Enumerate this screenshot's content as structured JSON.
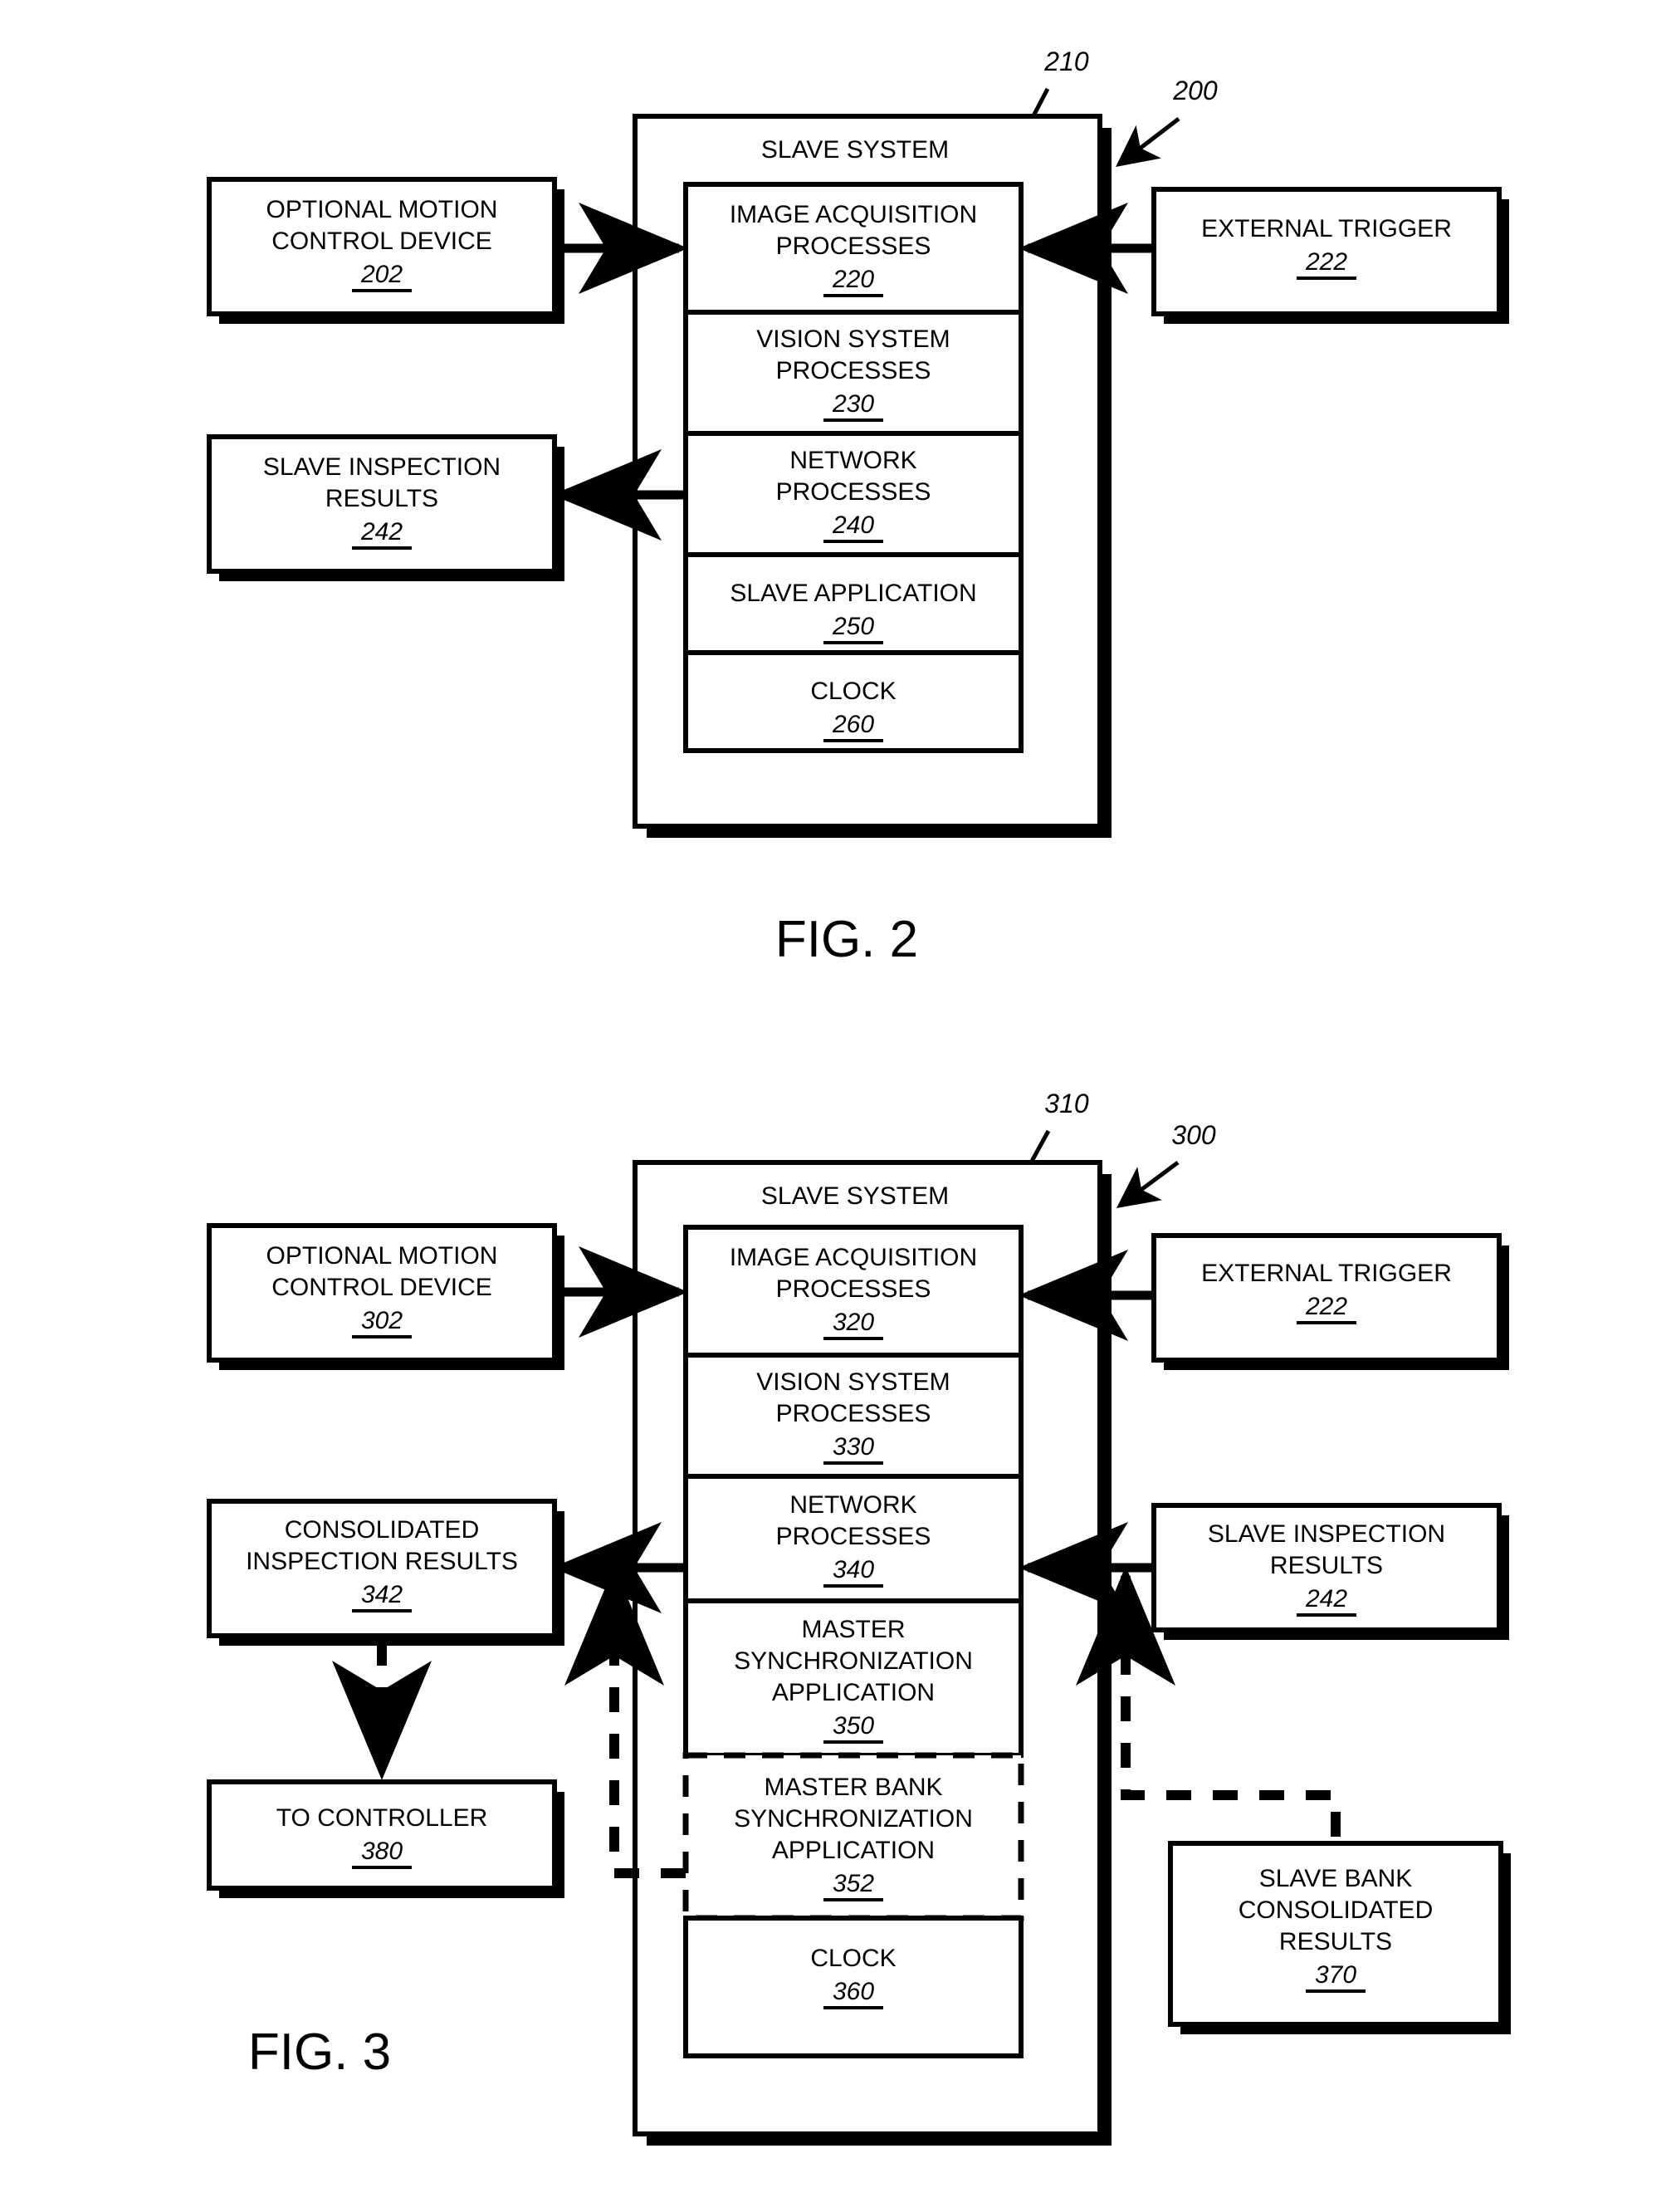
{
  "document": {
    "type": "patent-figure-sheet",
    "figures": [
      {
        "id": "fig2",
        "label": "FIG. 2",
        "system_ref": "200",
        "stack_ref": "210",
        "container": {
          "title": "SLAVE SYSTEM"
        },
        "stack_modules": [
          {
            "name": "IMAGE ACQUISITION PROCESSES",
            "lines": [
              "IMAGE ACQUISITION",
              "PROCESSES"
            ],
            "ref": "220",
            "dashed": false
          },
          {
            "name": "VISION SYSTEM PROCESSES",
            "lines": [
              "VISION SYSTEM",
              "PROCESSES"
            ],
            "ref": "230",
            "dashed": false
          },
          {
            "name": "NETWORK PROCESSES",
            "lines": [
              "NETWORK",
              "PROCESSES"
            ],
            "ref": "240",
            "dashed": false
          },
          {
            "name": "SLAVE APPLICATION",
            "lines": [
              "SLAVE APPLICATION"
            ],
            "ref": "250",
            "dashed": false
          },
          {
            "name": "CLOCK",
            "lines": [
              "CLOCK"
            ],
            "ref": "260",
            "dashed": false
          }
        ],
        "side_boxes": [
          {
            "name": "OPTIONAL MOTION CONTROL DEVICE",
            "lines": [
              "OPTIONAL MOTION",
              "CONTROL DEVICE"
            ],
            "ref": "202",
            "side": "left"
          },
          {
            "name": "SLAVE INSPECTION RESULTS",
            "lines": [
              "SLAVE INSPECTION",
              "RESULTS"
            ],
            "ref": "242",
            "side": "left"
          },
          {
            "name": "EXTERNAL TRIGGER",
            "lines": [
              "EXTERNAL TRIGGER"
            ],
            "ref": "222",
            "side": "right"
          }
        ]
      },
      {
        "id": "fig3",
        "label": "FIG. 3",
        "system_ref": "300",
        "stack_ref": "310",
        "container": {
          "title": "SLAVE SYSTEM"
        },
        "stack_modules": [
          {
            "name": "IMAGE ACQUISITION PROCESSES",
            "lines": [
              "IMAGE ACQUISITION",
              "PROCESSES"
            ],
            "ref": "320",
            "dashed": false
          },
          {
            "name": "VISION SYSTEM PROCESSES",
            "lines": [
              "VISION SYSTEM",
              "PROCESSES"
            ],
            "ref": "330",
            "dashed": false
          },
          {
            "name": "NETWORK PROCESSES",
            "lines": [
              "NETWORK",
              "PROCESSES"
            ],
            "ref": "340",
            "dashed": false
          },
          {
            "name": "MASTER SYNCHRONIZATION APPLICATION",
            "lines": [
              "MASTER",
              "SYNCHRONIZATION",
              "APPLICATION"
            ],
            "ref": "350",
            "dashed": false
          },
          {
            "name": "MASTER BANK SYNCHRONIZATION APPLICATION",
            "lines": [
              "MASTER BANK",
              "SYNCHRONIZATION",
              "APPLICATION"
            ],
            "ref": "352",
            "dashed": true
          },
          {
            "name": "CLOCK",
            "lines": [
              "CLOCK"
            ],
            "ref": "360",
            "dashed": false
          }
        ],
        "side_boxes": [
          {
            "name": "OPTIONAL MOTION CONTROL DEVICE",
            "lines": [
              "OPTIONAL MOTION",
              "CONTROL DEVICE"
            ],
            "ref": "302",
            "side": "left"
          },
          {
            "name": "CONSOLIDATED INSPECTION RESULTS",
            "lines": [
              "CONSOLIDATED",
              "INSPECTION RESULTS"
            ],
            "ref": "342",
            "side": "left"
          },
          {
            "name": "TO CONTROLLER",
            "lines": [
              "TO CONTROLLER"
            ],
            "ref": "380",
            "side": "left"
          },
          {
            "name": "EXTERNAL TRIGGER",
            "lines": [
              "EXTERNAL TRIGGER"
            ],
            "ref": "222",
            "side": "right"
          },
          {
            "name": "SLAVE INSPECTION RESULTS",
            "lines": [
              "SLAVE INSPECTION",
              "RESULTS"
            ],
            "ref": "242",
            "side": "right"
          },
          {
            "name": "SLAVE BANK CONSOLIDATED RESULTS",
            "lines": [
              "SLAVE BANK",
              "CONSOLIDATED",
              "RESULTS"
            ],
            "ref": "370",
            "side": "right"
          }
        ]
      }
    ],
    "colors": {
      "ink": "#000000",
      "paper": "#ffffff"
    }
  },
  "fig2": {
    "label": "FIG. 2",
    "container_title": "SLAVE SYSTEM",
    "callout_system": "200",
    "callout_stack": "210",
    "mod0_l0": "IMAGE ACQUISITION",
    "mod0_l1": "PROCESSES",
    "mod0_ref": "220",
    "mod1_l0": "VISION SYSTEM",
    "mod1_l1": "PROCESSES",
    "mod1_ref": "230",
    "mod2_l0": "NETWORK",
    "mod2_l1": "PROCESSES",
    "mod2_ref": "240",
    "mod3_l0": "SLAVE APPLICATION",
    "mod3_ref": "250",
    "mod4_l0": "CLOCK",
    "mod4_ref": "260",
    "lb0_l0": "OPTIONAL MOTION",
    "lb0_l1": "CONTROL DEVICE",
    "lb0_ref": "202",
    "lb1_l0": "SLAVE INSPECTION",
    "lb1_l1": "RESULTS",
    "lb1_ref": "242",
    "rb0_l0": "EXTERNAL TRIGGER",
    "rb0_ref": "222"
  },
  "fig3": {
    "label": "FIG. 3",
    "container_title": "SLAVE SYSTEM",
    "callout_system": "300",
    "callout_stack": "310",
    "mod0_l0": "IMAGE ACQUISITION",
    "mod0_l1": "PROCESSES",
    "mod0_ref": "320",
    "mod1_l0": "VISION SYSTEM",
    "mod1_l1": "PROCESSES",
    "mod1_ref": "330",
    "mod2_l0": "NETWORK",
    "mod2_l1": "PROCESSES",
    "mod2_ref": "340",
    "mod3_l0": "MASTER",
    "mod3_l1": "SYNCHRONIZATION",
    "mod3_l2": "APPLICATION",
    "mod3_ref": "350",
    "mod4_l0": "MASTER BANK",
    "mod4_l1": "SYNCHRONIZATION",
    "mod4_l2": "APPLICATION",
    "mod4_ref": "352",
    "mod5_l0": "CLOCK",
    "mod5_ref": "360",
    "lb0_l0": "OPTIONAL MOTION",
    "lb0_l1": "CONTROL DEVICE",
    "lb0_ref": "302",
    "lb1_l0": "CONSOLIDATED",
    "lb1_l1": "INSPECTION RESULTS",
    "lb1_ref": "342",
    "lb2_l0": "TO CONTROLLER",
    "lb2_ref": "380",
    "rb0_l0": "EXTERNAL TRIGGER",
    "rb0_ref": "222",
    "rb1_l0": "SLAVE INSPECTION",
    "rb1_l1": "RESULTS",
    "rb1_ref": "242",
    "rb2_l0": "SLAVE BANK",
    "rb2_l1": "CONSOLIDATED",
    "rb2_l2": "RESULTS",
    "rb2_ref": "370"
  }
}
